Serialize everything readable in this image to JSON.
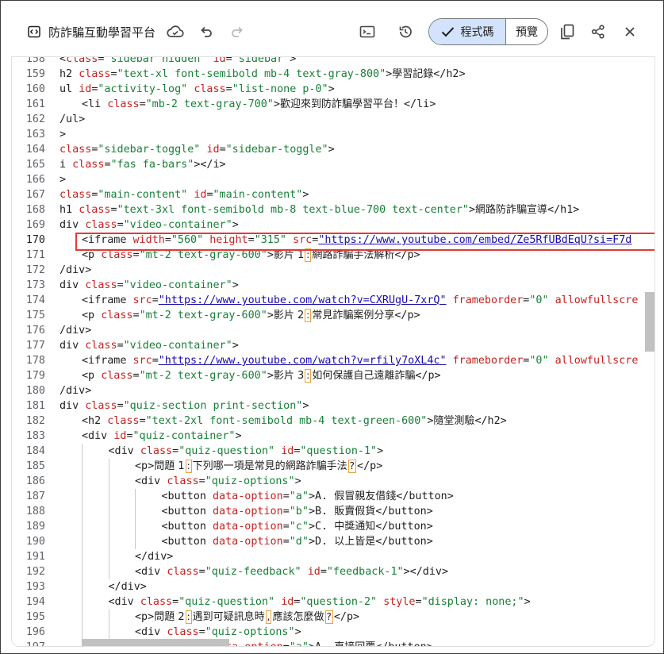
{
  "toolbar": {
    "title": "防詐騙互動學習平台",
    "code_label": "程式碼",
    "preview_label": "預覽"
  },
  "editor": {
    "active_line": "170",
    "lines": [
      {
        "n": "158",
        "indent": 0,
        "parts": [
          [
            "t",
            "<"
          ],
          [
            "a",
            "class"
          ],
          [
            "t",
            "="
          ],
          [
            "s",
            "\"sidebar hidden\""
          ],
          [
            "t",
            " "
          ],
          [
            "a",
            "id"
          ],
          [
            "t",
            "="
          ],
          [
            "s",
            "\"sidebar\""
          ],
          [
            "t",
            ">"
          ]
        ]
      },
      {
        "n": "159",
        "indent": 0,
        "parts": [
          [
            "t",
            "h2 "
          ],
          [
            "a",
            "class"
          ],
          [
            "t",
            "="
          ],
          [
            "s",
            "\"text-xl font-semibold mb-4 text-gray-800\""
          ],
          [
            "t",
            ">"
          ],
          [
            "c",
            "學習記錄"
          ],
          [
            "t",
            "</h2>"
          ]
        ]
      },
      {
        "n": "160",
        "indent": 0,
        "parts": [
          [
            "t",
            "ul "
          ],
          [
            "a",
            "id"
          ],
          [
            "t",
            "="
          ],
          [
            "s",
            "\"activity-log\""
          ],
          [
            "t",
            " "
          ],
          [
            "a",
            "class"
          ],
          [
            "t",
            "="
          ],
          [
            "s",
            "\"list-none p-0\""
          ],
          [
            "t",
            ">"
          ]
        ]
      },
      {
        "n": "161",
        "indent": 1,
        "parts": [
          [
            "t",
            "<li "
          ],
          [
            "a",
            "class"
          ],
          [
            "t",
            "="
          ],
          [
            "s",
            "\"mb-2 text-gray-700\""
          ],
          [
            "t",
            ">"
          ],
          [
            "c",
            "歡迎來到防詐騙學習平台！"
          ],
          [
            "t",
            "</li>"
          ]
        ]
      },
      {
        "n": "162",
        "indent": 0,
        "parts": [
          [
            "t",
            "/ul>"
          ]
        ]
      },
      {
        "n": "163",
        "indent": 0,
        "parts": [
          [
            "t",
            ">"
          ]
        ]
      },
      {
        "n": "164",
        "indent": 0,
        "parts": [
          [
            "a",
            "class"
          ],
          [
            "t",
            "="
          ],
          [
            "s",
            "\"sidebar-toggle\""
          ],
          [
            "t",
            " "
          ],
          [
            "a",
            "id"
          ],
          [
            "t",
            "="
          ],
          [
            "s",
            "\"sidebar-toggle\""
          ],
          [
            "t",
            ">"
          ]
        ]
      },
      {
        "n": "165",
        "indent": 0,
        "parts": [
          [
            "t",
            "i "
          ],
          [
            "a",
            "class"
          ],
          [
            "t",
            "="
          ],
          [
            "s",
            "\"fas fa-bars\""
          ],
          [
            "t",
            "></i>"
          ]
        ]
      },
      {
        "n": "166",
        "indent": 0,
        "parts": [
          [
            "t",
            ">"
          ]
        ]
      },
      {
        "n": "167",
        "indent": 0,
        "parts": [
          [
            "a",
            "class"
          ],
          [
            "t",
            "="
          ],
          [
            "s",
            "\"main-content\""
          ],
          [
            "t",
            " "
          ],
          [
            "a",
            "id"
          ],
          [
            "t",
            "="
          ],
          [
            "s",
            "\"main-content\""
          ],
          [
            "t",
            ">"
          ]
        ]
      },
      {
        "n": "168",
        "indent": 0,
        "parts": [
          [
            "t",
            "h1 "
          ],
          [
            "a",
            "class"
          ],
          [
            "t",
            "="
          ],
          [
            "s",
            "\"text-3xl font-semibold mb-8 text-blue-700 text-center\""
          ],
          [
            "t",
            ">"
          ],
          [
            "c",
            "網路防詐騙宣導"
          ],
          [
            "t",
            "</h1>"
          ]
        ]
      },
      {
        "n": "169",
        "indent": 0,
        "parts": [
          [
            "t",
            "div "
          ],
          [
            "a",
            "class"
          ],
          [
            "t",
            "="
          ],
          [
            "s",
            "\"video-container\""
          ],
          [
            "t",
            ">"
          ]
        ]
      },
      {
        "n": "170",
        "indent": 1,
        "parts": [
          [
            "t",
            "<iframe "
          ],
          [
            "a",
            "width"
          ],
          [
            "t",
            "="
          ],
          [
            "s",
            "\"560\""
          ],
          [
            "t",
            " "
          ],
          [
            "a",
            "height"
          ],
          [
            "t",
            "="
          ],
          [
            "s",
            "\"315\""
          ],
          [
            "t",
            " "
          ],
          [
            "a",
            "src"
          ],
          [
            "t",
            "="
          ],
          [
            "u",
            "\"https://www.youtube.com/embed/Ze5RfUBdEqU?si=F7d"
          ]
        ]
      },
      {
        "n": "171",
        "indent": 1,
        "parts": [
          [
            "t",
            "<p "
          ],
          [
            "a",
            "class"
          ],
          [
            "t",
            "="
          ],
          [
            "s",
            "\"mt-2 text-gray-600\""
          ],
          [
            "t",
            ">"
          ],
          [
            "c",
            "影片 1"
          ],
          [
            "b",
            ":"
          ],
          [
            "c",
            "網路詐騙手法解析"
          ],
          [
            "t",
            "</p>"
          ]
        ]
      },
      {
        "n": "172",
        "indent": 0,
        "parts": [
          [
            "t",
            "/div>"
          ]
        ]
      },
      {
        "n": "173",
        "indent": 0,
        "parts": [
          [
            "t",
            "div "
          ],
          [
            "a",
            "class"
          ],
          [
            "t",
            "="
          ],
          [
            "s",
            "\"video-container\""
          ],
          [
            "t",
            ">"
          ]
        ]
      },
      {
        "n": "174",
        "indent": 1,
        "parts": [
          [
            "t",
            "<iframe "
          ],
          [
            "a",
            "src"
          ],
          [
            "t",
            "="
          ],
          [
            "u",
            "\"https://www.youtube.com/watch?v=CXRUgU-7xrQ\""
          ],
          [
            "t",
            " "
          ],
          [
            "a",
            "frameborder"
          ],
          [
            "t",
            "="
          ],
          [
            "s",
            "\"0\""
          ],
          [
            "t",
            " "
          ],
          [
            "a",
            "allowfullscre"
          ]
        ]
      },
      {
        "n": "175",
        "indent": 1,
        "parts": [
          [
            "t",
            "<p "
          ],
          [
            "a",
            "class"
          ],
          [
            "t",
            "="
          ],
          [
            "s",
            "\"mt-2 text-gray-600\""
          ],
          [
            "t",
            ">"
          ],
          [
            "c",
            "影片 2"
          ],
          [
            "b",
            ":"
          ],
          [
            "c",
            "常見詐騙案例分享"
          ],
          [
            "t",
            "</p>"
          ]
        ]
      },
      {
        "n": "176",
        "indent": 0,
        "parts": [
          [
            "t",
            "/div>"
          ]
        ]
      },
      {
        "n": "177",
        "indent": 0,
        "parts": [
          [
            "t",
            "div "
          ],
          [
            "a",
            "class"
          ],
          [
            "t",
            "="
          ],
          [
            "s",
            "\"video-container\""
          ],
          [
            "t",
            ">"
          ]
        ]
      },
      {
        "n": "178",
        "indent": 1,
        "parts": [
          [
            "t",
            "<iframe "
          ],
          [
            "a",
            "src"
          ],
          [
            "t",
            "="
          ],
          [
            "u",
            "\"https://www.youtube.com/watch?v=rfily7oXL4c\""
          ],
          [
            "t",
            " "
          ],
          [
            "a",
            "frameborder"
          ],
          [
            "t",
            "="
          ],
          [
            "s",
            "\"0\""
          ],
          [
            "t",
            " "
          ],
          [
            "a",
            "allowfullscre"
          ]
        ]
      },
      {
        "n": "179",
        "indent": 1,
        "parts": [
          [
            "t",
            "<p "
          ],
          [
            "a",
            "class"
          ],
          [
            "t",
            "="
          ],
          [
            "s",
            "\"mt-2 text-gray-600\""
          ],
          [
            "t",
            ">"
          ],
          [
            "c",
            "影片 3"
          ],
          [
            "b",
            ":"
          ],
          [
            "c",
            "如何保護自己遠離詐騙"
          ],
          [
            "t",
            "</p>"
          ]
        ]
      },
      {
        "n": "180",
        "indent": 0,
        "parts": [
          [
            "t",
            "/div>"
          ]
        ]
      },
      {
        "n": "181",
        "indent": 0,
        "parts": [
          [
            "t",
            "div "
          ],
          [
            "a",
            "class"
          ],
          [
            "t",
            "="
          ],
          [
            "s",
            "\"quiz-section print-section\""
          ],
          [
            "t",
            ">"
          ]
        ]
      },
      {
        "n": "182",
        "indent": 1,
        "parts": [
          [
            "t",
            "<h2 "
          ],
          [
            "a",
            "class"
          ],
          [
            "t",
            "="
          ],
          [
            "s",
            "\"text-2xl font-semibold mb-4 text-green-600\""
          ],
          [
            "t",
            ">"
          ],
          [
            "c",
            "隨堂測驗"
          ],
          [
            "t",
            "</h2>"
          ]
        ]
      },
      {
        "n": "183",
        "indent": 1,
        "parts": [
          [
            "t",
            "<div "
          ],
          [
            "a",
            "id"
          ],
          [
            "t",
            "="
          ],
          [
            "s",
            "\"quiz-container\""
          ],
          [
            "t",
            ">"
          ]
        ]
      },
      {
        "n": "184",
        "indent": 2,
        "parts": [
          [
            "t",
            "<div "
          ],
          [
            "a",
            "class"
          ],
          [
            "t",
            "="
          ],
          [
            "s",
            "\"quiz-question\""
          ],
          [
            "t",
            " "
          ],
          [
            "a",
            "id"
          ],
          [
            "t",
            "="
          ],
          [
            "s",
            "\"question-1\""
          ],
          [
            "t",
            ">"
          ]
        ]
      },
      {
        "n": "185",
        "indent": 3,
        "parts": [
          [
            "t",
            "<p>"
          ],
          [
            "c",
            "問題 1"
          ],
          [
            "b",
            ":"
          ],
          [
            "c",
            "下列哪一項是常見的網路詐騙手法"
          ],
          [
            "b",
            "?"
          ],
          [
            "t",
            "</p>"
          ]
        ]
      },
      {
        "n": "186",
        "indent": 3,
        "parts": [
          [
            "t",
            "<div "
          ],
          [
            "a",
            "class"
          ],
          [
            "t",
            "="
          ],
          [
            "s",
            "\"quiz-options\""
          ],
          [
            "t",
            ">"
          ]
        ]
      },
      {
        "n": "187",
        "indent": 4,
        "parts": [
          [
            "t",
            "<button "
          ],
          [
            "a",
            "data-option"
          ],
          [
            "t",
            "="
          ],
          [
            "s",
            "\"a\""
          ],
          [
            "t",
            ">A. "
          ],
          [
            "c",
            "假冒親友借錢"
          ],
          [
            "t",
            "</button>"
          ]
        ]
      },
      {
        "n": "188",
        "indent": 4,
        "parts": [
          [
            "t",
            "<button "
          ],
          [
            "a",
            "data-option"
          ],
          [
            "t",
            "="
          ],
          [
            "s",
            "\"b\""
          ],
          [
            "t",
            ">B. "
          ],
          [
            "c",
            "販賣假貨"
          ],
          [
            "t",
            "</button>"
          ]
        ]
      },
      {
        "n": "189",
        "indent": 4,
        "parts": [
          [
            "t",
            "<button "
          ],
          [
            "a",
            "data-option"
          ],
          [
            "t",
            "="
          ],
          [
            "s",
            "\"c\""
          ],
          [
            "t",
            ">C. "
          ],
          [
            "c",
            "中獎通知"
          ],
          [
            "t",
            "</button>"
          ]
        ]
      },
      {
        "n": "190",
        "indent": 4,
        "parts": [
          [
            "t",
            "<button "
          ],
          [
            "a",
            "data-option"
          ],
          [
            "t",
            "="
          ],
          [
            "s",
            "\"d\""
          ],
          [
            "t",
            ">D. "
          ],
          [
            "c",
            "以上皆是"
          ],
          [
            "t",
            "</button>"
          ]
        ]
      },
      {
        "n": "191",
        "indent": 3,
        "parts": [
          [
            "t",
            "</div>"
          ]
        ]
      },
      {
        "n": "192",
        "indent": 3,
        "parts": [
          [
            "t",
            "<div "
          ],
          [
            "a",
            "class"
          ],
          [
            "t",
            "="
          ],
          [
            "s",
            "\"quiz-feedback\""
          ],
          [
            "t",
            " "
          ],
          [
            "a",
            "id"
          ],
          [
            "t",
            "="
          ],
          [
            "s",
            "\"feedback-1\""
          ],
          [
            "t",
            "></div>"
          ]
        ]
      },
      {
        "n": "193",
        "indent": 2,
        "parts": [
          [
            "t",
            "</div>"
          ]
        ]
      },
      {
        "n": "194",
        "indent": 2,
        "parts": [
          [
            "t",
            "<div "
          ],
          [
            "a",
            "class"
          ],
          [
            "t",
            "="
          ],
          [
            "s",
            "\"quiz-question\""
          ],
          [
            "t",
            " "
          ],
          [
            "a",
            "id"
          ],
          [
            "t",
            "="
          ],
          [
            "s",
            "\"question-2\""
          ],
          [
            "t",
            " "
          ],
          [
            "a",
            "style"
          ],
          [
            "t",
            "="
          ],
          [
            "s",
            "\"display: none;\""
          ],
          [
            "t",
            ">"
          ]
        ]
      },
      {
        "n": "195",
        "indent": 3,
        "parts": [
          [
            "t",
            "<p>"
          ],
          [
            "c",
            "問題 2"
          ],
          [
            "b",
            ":"
          ],
          [
            "c",
            "遇到可疑訊息時"
          ],
          [
            "b",
            ","
          ],
          [
            "c",
            "應該怎麼做"
          ],
          [
            "b",
            "?"
          ],
          [
            "t",
            "</p>"
          ]
        ]
      },
      {
        "n": "196",
        "indent": 3,
        "parts": [
          [
            "t",
            "<div "
          ],
          [
            "a",
            "class"
          ],
          [
            "t",
            "="
          ],
          [
            "s",
            "\"quiz-options\""
          ],
          [
            "t",
            ">"
          ]
        ]
      },
      {
        "n": "197",
        "indent": 4,
        "parts": [
          [
            "t",
            "<button "
          ],
          [
            "a",
            "data-option"
          ],
          [
            "t",
            "="
          ],
          [
            "s",
            "\"a\""
          ],
          [
            "t",
            ">A. "
          ],
          [
            "c",
            "直接回覆"
          ],
          [
            "t",
            "</button>"
          ]
        ]
      }
    ]
  }
}
